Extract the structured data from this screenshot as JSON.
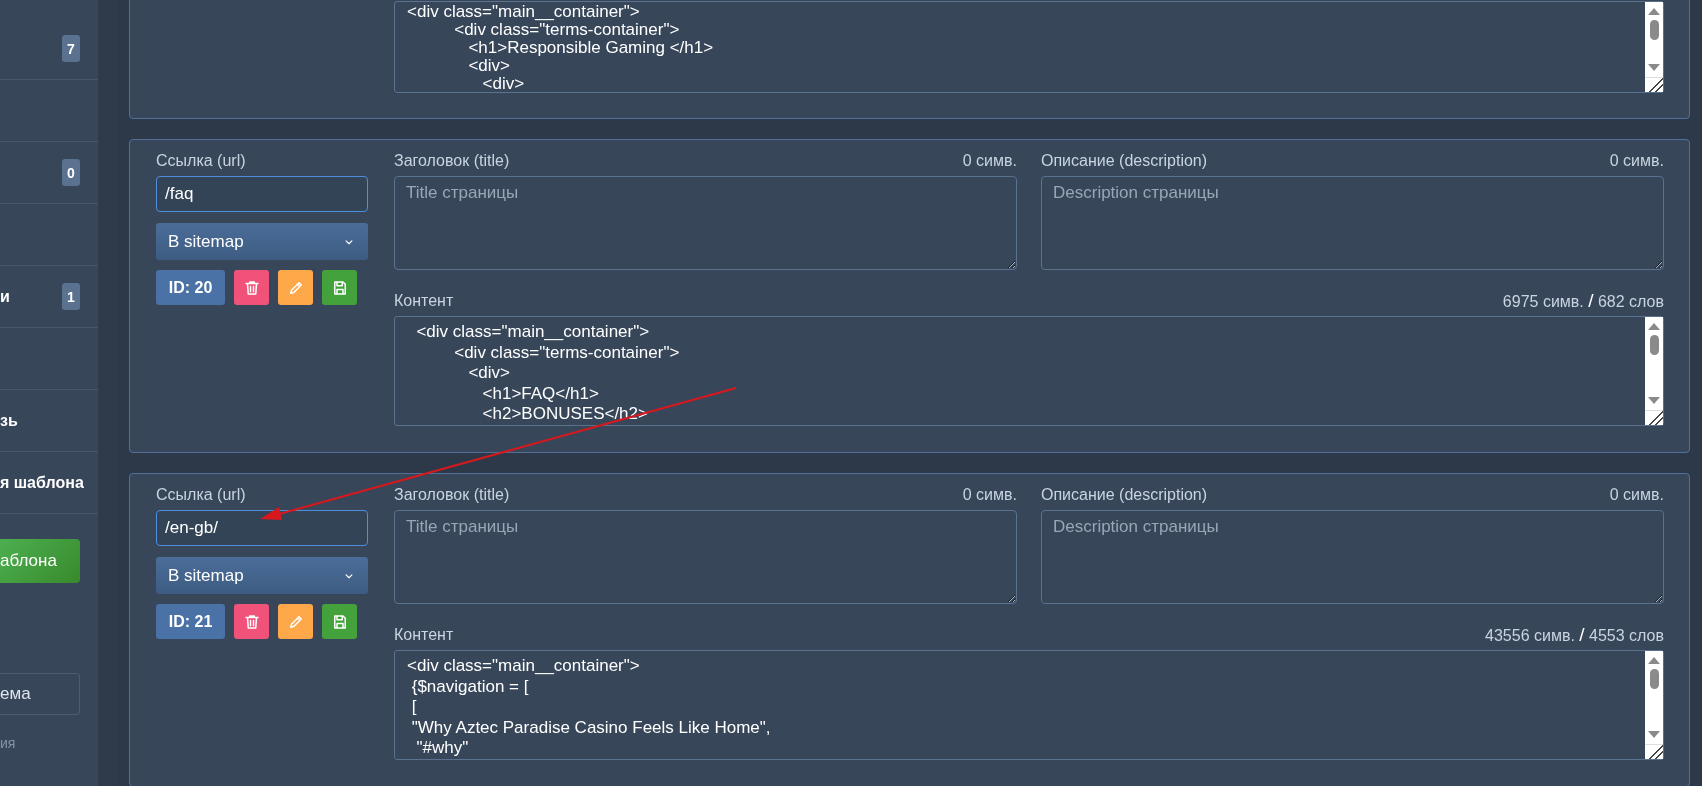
{
  "sidebar": {
    "items": [
      {
        "kind": "badge",
        "badge": "7"
      },
      {
        "kind": "blank"
      },
      {
        "kind": "badge",
        "badge": "0"
      },
      {
        "kind": "blank"
      },
      {
        "kind": "badge",
        "label": "и",
        "badge": "1"
      },
      {
        "kind": "blank"
      },
      {
        "kind": "label",
        "label": "зь"
      },
      {
        "kind": "label",
        "label": "я шаблона"
      }
    ],
    "button": "аблона",
    "field": {
      "value": "ема"
    },
    "note": "ия"
  },
  "cards": [
    {
      "content": {
        "value": "<div class=\"main__container\">\n          <div class=\"terms-container\">\n             <h1>Responsible Gaming </h1>\n             <div>\n                <div>"
      }
    },
    {
      "url": {
        "label": "Ссылка (url)",
        "value": "/faq"
      },
      "sitemap_select": "В sitemap",
      "id_badge": "ID: 20",
      "title": {
        "label": "Заголовок (title)",
        "count": "0 симв.",
        "placeholder": "Title страницы"
      },
      "description": {
        "label": "Описание (description)",
        "count": "0 симв.",
        "placeholder": "Description страницы"
      },
      "content": {
        "label": "Контент",
        "count": "6975 симв. **/** 682 слов",
        "value": "  <div class=\"main__container\">\n          <div class=\"terms-container\">\n             <div>\n                <h1>FAQ</h1>\n                <h2>BONUSES</h2>"
      }
    },
    {
      "url": {
        "label": "Ссылка (url)",
        "value": "/en-gb/"
      },
      "sitemap_select": "В sitemap",
      "id_badge": "ID: 21",
      "title": {
        "label": "Заголовок (title)",
        "count": "0 симв.",
        "placeholder": "Title страницы"
      },
      "description": {
        "label": "Описание (description)",
        "count": "0 симв.",
        "placeholder": "Description страницы"
      },
      "content": {
        "label": "Контент",
        "count": "43556 симв. **/** 4553 слов",
        "value": "<div class=\"main__container\">\n {$navigation = [\n [\n \"Why Aztec Paradise Casino Feels Like Home\",\n  \"#why\""
      }
    }
  ]
}
